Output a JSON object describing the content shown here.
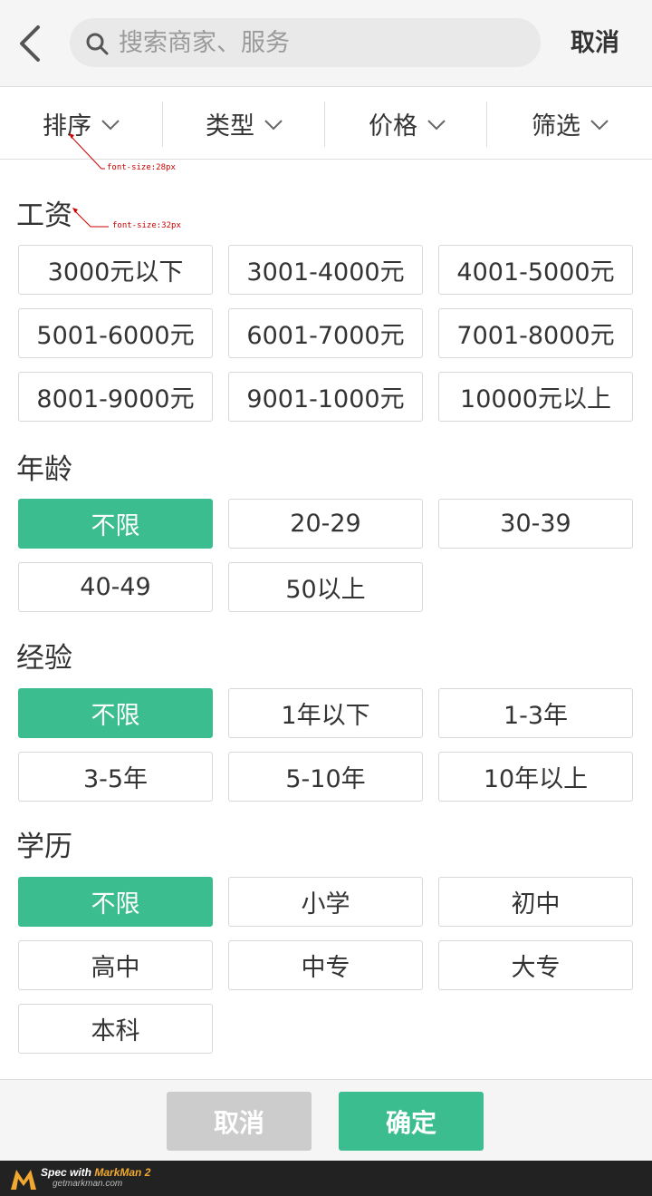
{
  "header": {
    "search_placeholder": "搜索商家、服务",
    "cancel_label": "取消"
  },
  "tabs": [
    {
      "label": "排序"
    },
    {
      "label": "类型"
    },
    {
      "label": "价格"
    },
    {
      "label": "筛选"
    }
  ],
  "annotations": {
    "tab_font": "font-size:28px",
    "title_font": "font-size:32px"
  },
  "sections": [
    {
      "title": "工资",
      "options": [
        "3000元以下",
        "3001-4000元",
        "4001-5000元",
        "5001-6000元",
        "6001-7000元",
        "7001-8000元",
        "8001-9000元",
        "9001-1000元",
        "10000元以上"
      ],
      "selected": null
    },
    {
      "title": "年龄",
      "options": [
        "不限",
        "20-29",
        "30-39",
        "40-49",
        "50以上"
      ],
      "selected": "不限"
    },
    {
      "title": "经验",
      "options": [
        "不限",
        "1年以下",
        "1-3年",
        "3-5年",
        "5-10年",
        "10年以上"
      ],
      "selected": "不限"
    },
    {
      "title": "学历",
      "options": [
        "不限",
        "小学",
        "初中",
        "高中",
        "中专",
        "大专",
        "本科"
      ],
      "selected": "不限"
    }
  ],
  "footer_buttons": {
    "cancel_label": "取消",
    "confirm_label": "确定"
  },
  "watermark": {
    "spec_with": "Spec with",
    "brand": "MarkMan 2",
    "url": "getmarkman.com"
  },
  "colors": {
    "accent": "#3cbd90",
    "disabled": "#cccccc",
    "border": "#d8d8d8"
  },
  "icons": [
    "back-arrow-icon",
    "search-icon",
    "chevron-down-icon",
    "markman-logo-icon"
  ]
}
